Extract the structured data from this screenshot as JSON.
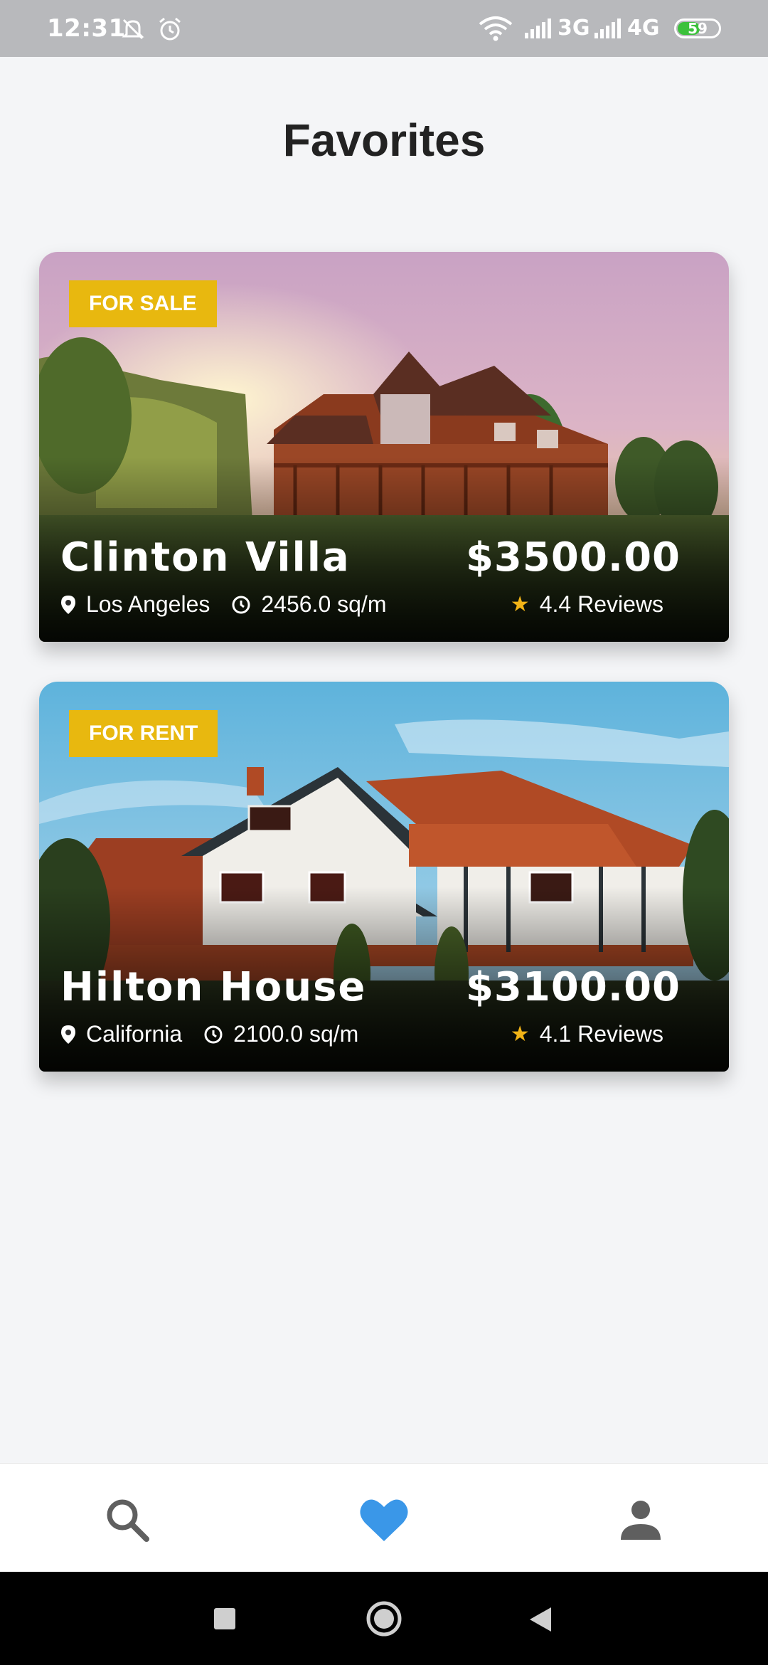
{
  "status_bar": {
    "time": "12:31",
    "net1": "3G",
    "net2": "4G",
    "battery": "59",
    "battery_level": 0.59,
    "icons": [
      "mute-icon",
      "alarm-icon",
      "wifi-icon",
      "signal-icon",
      "signal-icon",
      "battery-icon"
    ]
  },
  "page": {
    "title": "Favorites"
  },
  "listings": [
    {
      "badge": "FOR SALE",
      "name": "Clinton Villa",
      "price": "$3500.00",
      "location": "Los Angeles",
      "area": "2456.0 sq/m",
      "rating": "4.4 Reviews"
    },
    {
      "badge": "FOR RENT",
      "name": "Hilton House",
      "price": "$3100.00",
      "location": "California",
      "area": "2100.0 sq/m",
      "rating": "4.1 Reviews"
    }
  ],
  "nav": {
    "items": [
      {
        "icon": "search-icon",
        "active": false
      },
      {
        "icon": "heart-icon",
        "active": true
      },
      {
        "icon": "person-icon",
        "active": false
      }
    ],
    "active_color": "#3a97e8",
    "inactive_color": "#5f5f5f"
  },
  "colors": {
    "badge": "#e8b80f",
    "star": "#f2b417",
    "background": "#f4f5f7"
  }
}
